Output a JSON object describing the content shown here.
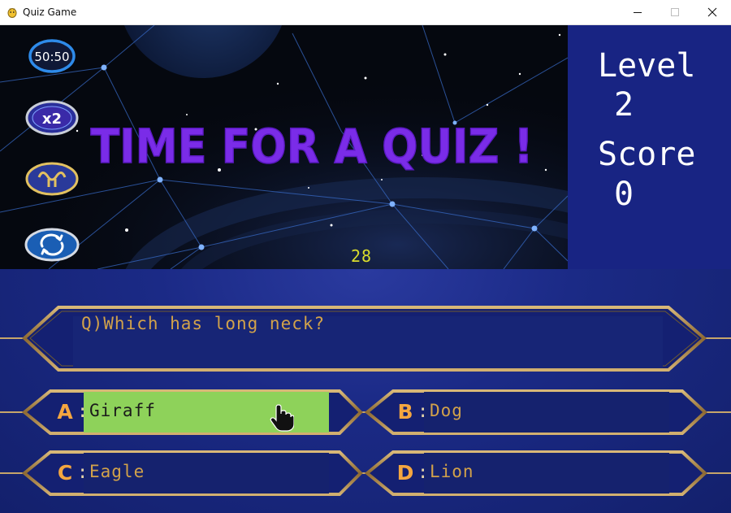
{
  "window": {
    "title": "Quiz Game",
    "controls": [
      "minimize-icon",
      "maximize-icon",
      "close-icon"
    ]
  },
  "banner": {
    "title": "TIME FOR A QUIZ !",
    "title_color": "#7a2ce8",
    "timer": "28",
    "timer_color": "#d9dc2c"
  },
  "lifelines": [
    {
      "name": "fifty-fifty",
      "label": "50:50",
      "icon": "fifty-fifty-icon"
    },
    {
      "name": "double-dip",
      "label": "x2",
      "icon": "double-dip-icon"
    },
    {
      "name": "ask-expert",
      "icon": "ask-expert-icon"
    },
    {
      "name": "switch-question",
      "icon": "switch-question-icon"
    }
  ],
  "stats": {
    "level_label": "Level",
    "level": "2",
    "score_label": "Score",
    "score": "0"
  },
  "question": {
    "text": "Q)Which has long neck?"
  },
  "answers": [
    {
      "letter": "A",
      "text": "Giraff",
      "selected": true
    },
    {
      "letter": "B",
      "text": "Dog",
      "selected": false
    },
    {
      "letter": "C",
      "text": "Eagle",
      "selected": false
    },
    {
      "letter": "D",
      "text": "Lion",
      "selected": false
    }
  ],
  "colors": {
    "answer_text": "#d2a24a",
    "answer_letter": "#f4a640",
    "selected_answer_bg": "#8ed25a",
    "panel_bg": "#182483",
    "frame_gold": "#b9955a"
  }
}
